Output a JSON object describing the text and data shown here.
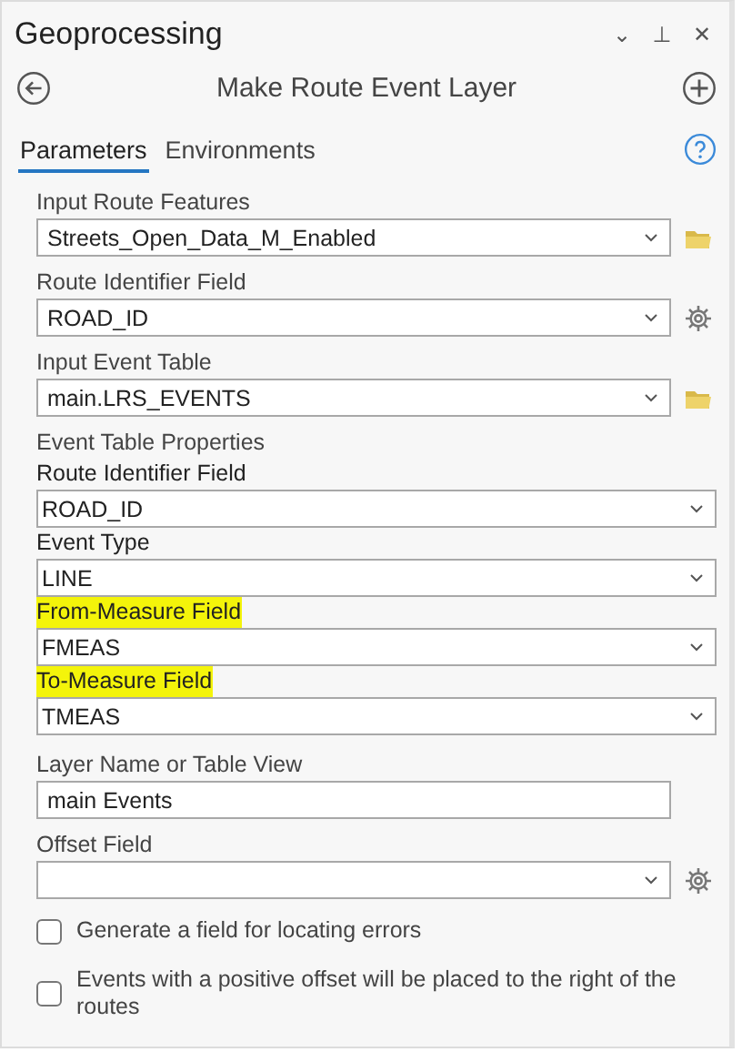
{
  "window": {
    "title": "Geoprocessing",
    "controls": [
      "⌄",
      "⊥",
      "✕"
    ]
  },
  "tool": {
    "title": "Make Route Event Layer"
  },
  "tabs": [
    {
      "label": "Parameters",
      "selected": true
    },
    {
      "label": "Environments",
      "selected": false
    }
  ],
  "parameters": [
    {
      "kind": "dropdown",
      "label": "Input Route Features",
      "value": "Streets_Open_Data_M_Enabled",
      "side_button": {
        "kind": "folder"
      }
    },
    {
      "kind": "dropdown",
      "label": "Route Identifier Field",
      "value": "ROAD_ID",
      "side_button": {
        "kind": "gear"
      }
    },
    {
      "kind": "dropdown",
      "label": "Input Event Table",
      "value": "main.LRS_EVENTS",
      "side_button": {
        "kind": "folder"
      }
    },
    {
      "kind": "group",
      "label": "Event Table Properties",
      "children": [
        {
          "label": "Route Identifier Field",
          "value": "ROAD_ID",
          "highlighted": false
        },
        {
          "label": "Event Type",
          "value": "LINE",
          "highlighted": false
        },
        {
          "label": "From-Measure Field",
          "value": "FMEAS",
          "highlighted": true
        },
        {
          "label": "To-Measure Field",
          "value": "TMEAS",
          "highlighted": true
        }
      ]
    },
    {
      "kind": "text",
      "label": "Layer Name or Table View",
      "value": "main Events"
    },
    {
      "kind": "dropdown",
      "label": "Offset Field",
      "side_button": {
        "kind": "gear"
      }
    },
    {
      "kind": "checkbox",
      "label": "Generate a field for locating errors",
      "checked": false
    },
    {
      "kind": "checkbox",
      "label": "Events with a positive offset will be placed to the right of the routes",
      "checked": false
    }
  ]
}
